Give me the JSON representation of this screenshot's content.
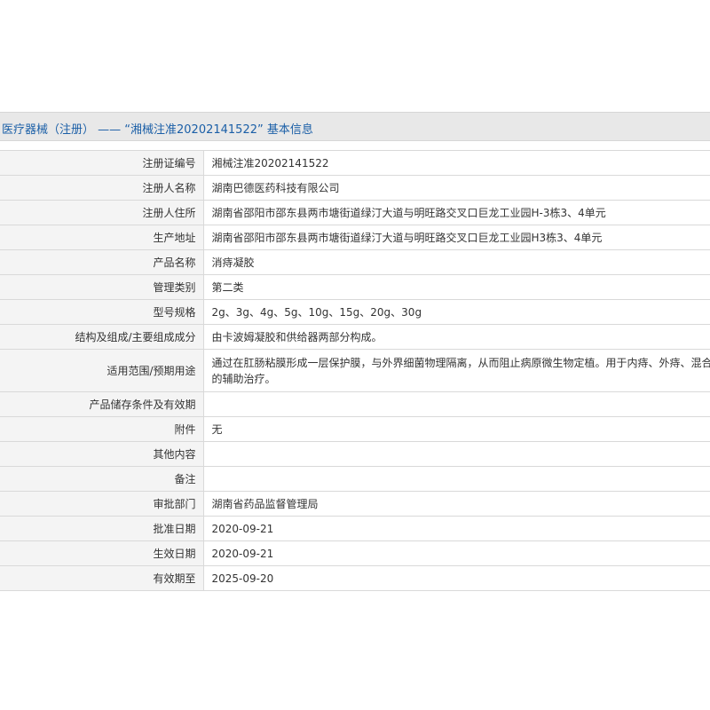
{
  "header": {
    "title": "医疗器械（注册） —— “湘械注准20202141522” 基本信息"
  },
  "rows": [
    {
      "label": "注册证编号",
      "value": "湘械注准20202141522"
    },
    {
      "label": "注册人名称",
      "value": "湖南巴德医药科技有限公司"
    },
    {
      "label": "注册人住所",
      "value": "湖南省邵阳市邵东县两市塘街道绿汀大道与明旺路交叉口巨龙工业园H-3栋3、4单元"
    },
    {
      "label": "生产地址",
      "value": "湖南省邵阳市邵东县两市塘街道绿汀大道与明旺路交叉口巨龙工业园H3栋3、4单元"
    },
    {
      "label": "产品名称",
      "value": "消痔凝胶"
    },
    {
      "label": "管理类别",
      "value": "第二类"
    },
    {
      "label": "型号规格",
      "value": "2g、3g、4g、5g、10g、15g、20g、30g"
    },
    {
      "label": "结构及组成/主要组成成分",
      "value": "由卡波姆凝胶和供给器两部分构成。"
    },
    {
      "label": "适用范围/预期用途",
      "value": "通过在肛肠粘膜形成一层保护膜，与外界细菌物理隔离，从而阻止病原微生物定植。用于内痔、外痔、混合痔的辅助治疗。"
    },
    {
      "label": "产品储存条件及有效期",
      "value": ""
    },
    {
      "label": "附件",
      "value": "无"
    },
    {
      "label": "其他内容",
      "value": ""
    },
    {
      "label": "备注",
      "value": ""
    },
    {
      "label": "审批部门",
      "value": "湖南省药品监督管理局"
    },
    {
      "label": "批准日期",
      "value": "2020-09-21"
    },
    {
      "label": "生效日期",
      "value": "2020-09-21"
    },
    {
      "label": "有效期至",
      "value": "2025-09-20"
    }
  ]
}
